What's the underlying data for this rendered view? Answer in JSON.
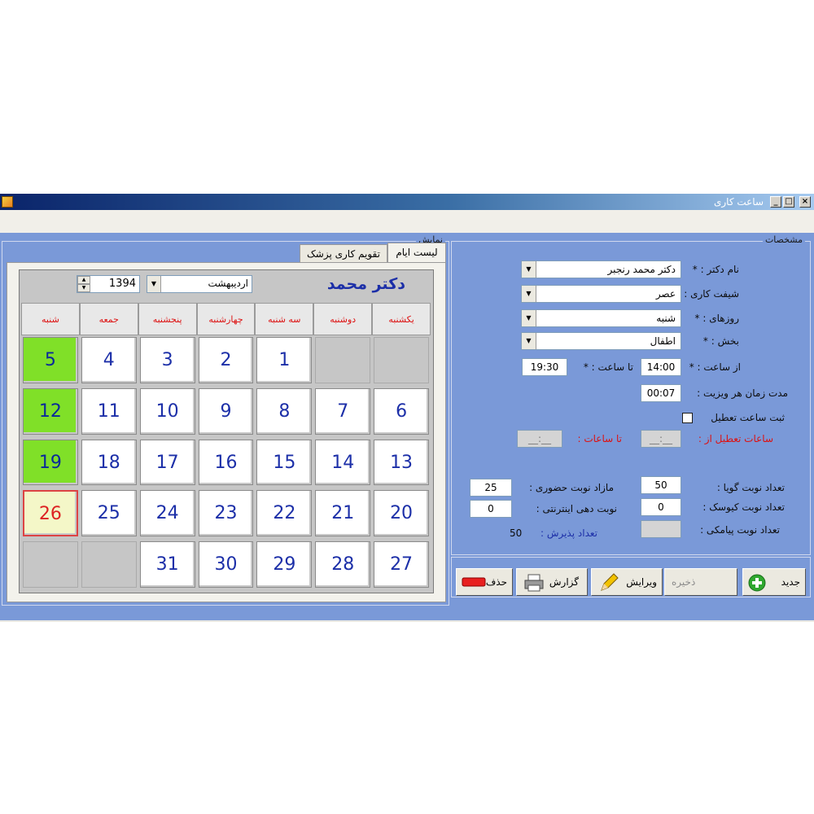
{
  "window": {
    "title": "ساعت کاری"
  },
  "group_display": {
    "legend": "نمایش"
  },
  "group_specs": {
    "legend": "مشخصات"
  },
  "tabs": [
    {
      "label": "لیست ایام",
      "active": true
    },
    {
      "label": "تقویم کاری پزشک",
      "active": false
    }
  ],
  "calendar": {
    "doctor_title": "دکتر محمد",
    "month": "اردیبهشت",
    "year": "1394",
    "weekdays": [
      "یکشنبه",
      "دوشنبه",
      "سه شنبه",
      "چهارشنبه",
      "پنجشنبه",
      "جمعه",
      "شنبه"
    ],
    "weeks": [
      [
        "",
        "",
        "1",
        "2",
        "3",
        "4",
        "5"
      ],
      [
        "6",
        "7",
        "8",
        "9",
        "10",
        "11",
        "12"
      ],
      [
        "13",
        "14",
        "15",
        "16",
        "17",
        "18",
        "19"
      ],
      [
        "20",
        "21",
        "22",
        "23",
        "24",
        "25",
        "26"
      ],
      [
        "27",
        "28",
        "29",
        "30",
        "31",
        "",
        ""
      ]
    ],
    "highlight_saturday_color": "#80e028",
    "today": "26"
  },
  "form": {
    "doctor_label": "نام دکتر :",
    "doctor_value": "دکتر محمد رنجبر",
    "shift_label": "شیفت کاری :",
    "shift_value": "عصر",
    "days_label": "روزهای :",
    "days_value": "شنبه",
    "section_label": "بخش :",
    "section_value": "اطفال",
    "required_mark": "*",
    "from_time_label": "از ساعت :",
    "from_time_value": "14:00",
    "to_time_label": "تا ساعت :",
    "to_time_value": "19:30",
    "duration_label": "مدت زمان هر ویزیت :",
    "duration_value": "00:07",
    "holiday_check_label": "ثبت ساعت تعطیل",
    "holiday_from_label": "ساعات تعطیل از :",
    "holiday_from_value": "__:__",
    "holiday_to_label": "تا ساعات :",
    "holiday_to_value": "__:__",
    "talking_label": "تعداد نوبت گویا :",
    "talking_value": "50",
    "kiosk_label": "تعداد نوبت کیوسک :",
    "kiosk_value": "0",
    "sms_label": "تعداد نوبت پیامکی :",
    "sms_value": "",
    "inperson_label": "مازاد نوبت حضوری :",
    "inperson_value": "25",
    "internet_label": "نوبت دهی اینترنتی :",
    "internet_value": "0",
    "admission_label": "تعداد پذیرش :",
    "admission_value": "50"
  },
  "buttons": {
    "new": "جدید",
    "save": "ذخیره",
    "edit": "ویرایش",
    "report": "گزارش",
    "delete": "حذف"
  }
}
